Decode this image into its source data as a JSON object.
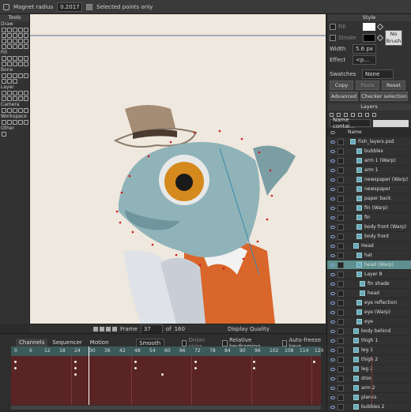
{
  "topbar": {
    "magnet_label": "Magnet radius",
    "magnet_value": "0.2017",
    "selected_only_label": "Selected points only"
  },
  "tools": {
    "title": "Tools",
    "groups": [
      "Draw",
      "Fill",
      "Bone",
      "Layer",
      "Camera",
      "Workspace",
      "Other"
    ]
  },
  "canvas_bar": {
    "frame_label": "Frame",
    "frame_value": "37",
    "of_label": "of",
    "of_value": "160",
    "display_quality": "Display Quality"
  },
  "style": {
    "title": "Style",
    "fill_label": "Fill",
    "stroke_label": "Stroke",
    "width_label": "Width",
    "width_value": "5.6 px",
    "effect_label": "Effect",
    "effect_value": "<p...",
    "no_brush": "No Brush",
    "swatches_label": "Swatches",
    "swatches_value": "None",
    "copy": "Copy",
    "paste": "Paste",
    "reset": "Reset",
    "advanced": "Advanced",
    "checker": "Checker selection"
  },
  "layers": {
    "title": "Layers",
    "filter_value": "Name contai...",
    "name_header": "Name",
    "items": [
      "Fish_layers.psd",
      "bubbles",
      "arm 1 (Warp)",
      "arm 1",
      "newspaper (Warp)",
      "newspaper",
      "paper back",
      "fin (Warp)",
      "fin",
      "body front (Warp)",
      "body front",
      "Head",
      "hat",
      "head (Warp)",
      "Layer 8",
      "fin shade",
      "head",
      "eye reflection",
      "eye (Warp)",
      "eye",
      "body behind",
      "thigh 1",
      "leg 1",
      "thigh 2",
      "leg 2",
      "stool",
      "arm 2",
      "planks",
      "bubbles 2"
    ]
  },
  "timeline": {
    "tabs": [
      "Channels",
      "Sequencer",
      "Motion Graph"
    ],
    "smooth": "Smooth",
    "onion": "Onion skins",
    "relative": "Relative keyframing",
    "autofreeze": "Auto-freeze keys",
    "ruler": [
      "0",
      "6",
      "12",
      "18",
      "24",
      "30",
      "36",
      "42",
      "48",
      "54",
      "60",
      "66",
      "72",
      "78",
      "84",
      "90",
      "96",
      "102",
      "108",
      "114",
      "120"
    ]
  }
}
